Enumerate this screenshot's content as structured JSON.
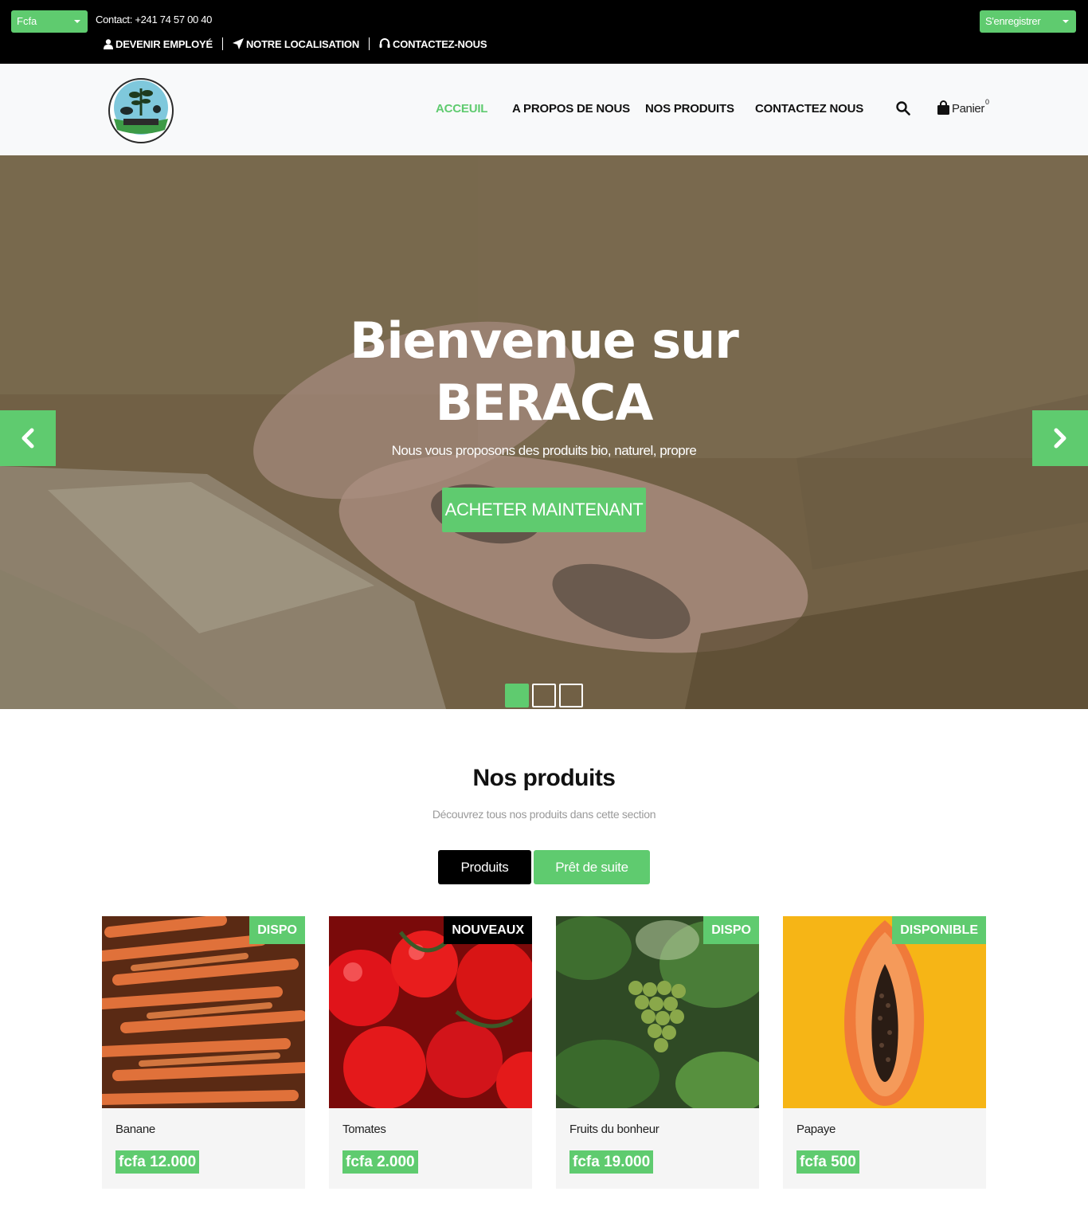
{
  "topbar": {
    "currency": "Fcfa",
    "contact": "Contact: +241 74 57 00 40",
    "links": [
      "DEVENIR EMPLOYÉ",
      "NOTRE LOCALISATION",
      "CONTACTEZ-NOUS"
    ],
    "register": "S'enregistrer"
  },
  "nav": {
    "items": [
      "ACCEUIL",
      "A PROPOS DE NOUS",
      "NOS PRODUITS",
      "CONTACTEZ NOUS"
    ],
    "active": "ACCEUIL",
    "cart_label": "Panier",
    "cart_count": "0"
  },
  "hero": {
    "title_line1": "Bienvenue sur",
    "title_line2": "BERACA",
    "subtitle": "Nous vous proposons des produits bio, naturel, propre",
    "cta": "ACHETER MAINTENANT",
    "slides": 3,
    "active_slide": 1
  },
  "products_section": {
    "title": "Nos produits",
    "subtitle": "Découvrez tous nos produits dans cette section",
    "tabs": [
      "Produits",
      "Prêt de suite"
    ]
  },
  "products": [
    {
      "name": "Banane",
      "price": "fcfa 12.000",
      "badge": "DISPO"
    },
    {
      "name": "Tomates",
      "price": "fcfa 2.000",
      "badge": "NOUVEAUX"
    },
    {
      "name": "Fruits du bonheur",
      "price": "fcfa 19.000",
      "badge": "DISPO"
    },
    {
      "name": "Papaye",
      "price": "fcfa 500",
      "badge": "DISPONIBLE"
    }
  ],
  "colors": {
    "accent": "#5fcb6f",
    "topbar": "#000000",
    "navbar": "#f8f9fa"
  }
}
